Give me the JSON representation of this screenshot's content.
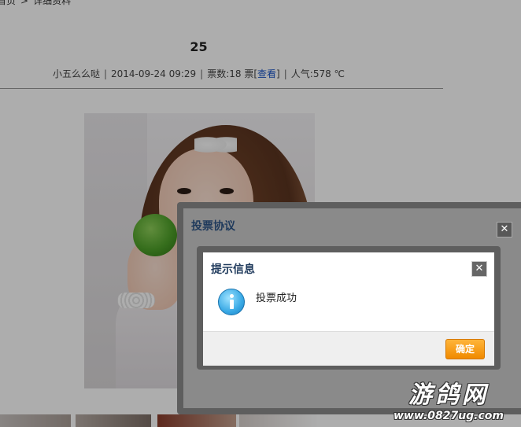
{
  "breadcrumb": {
    "first": "首页",
    "separator": ">",
    "current": "详细资料"
  },
  "post": {
    "title": "25",
    "author": "小五么么哒",
    "datetime": "2014-09-24 09:29",
    "votes": "票数:18 票",
    "view_open": "[",
    "view_link": "查看",
    "view_close": "]",
    "popularity": "人气:578 ℃"
  },
  "outer_dialog": {
    "title": "投票协议",
    "close_glyph": "✕"
  },
  "inner_dialog": {
    "title": "提示信息",
    "close_glyph": "✕",
    "message": "投票成功",
    "ok_label": "确定"
  },
  "watermark": {
    "name": "游鸽网",
    "url": "www.0827ug.com"
  },
  "colors": {
    "dialog_title": "#1f3a5c",
    "ok_button": "#f08a00",
    "link": "#1a55c6"
  }
}
